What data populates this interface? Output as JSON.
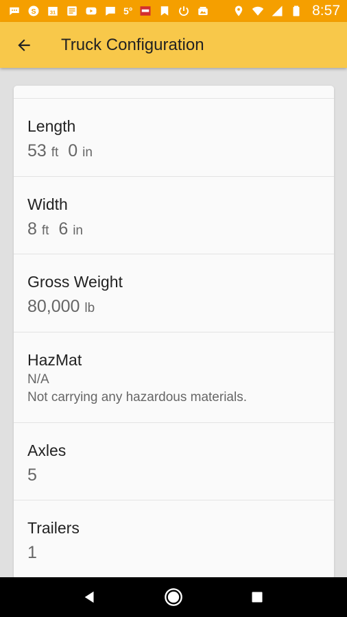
{
  "status_bar": {
    "clock": "8:57",
    "temperature": "5°",
    "icons": [
      "sms-icon",
      "skype-icon",
      "calendar-icon",
      "news-icon",
      "youtube-icon",
      "chat-icon",
      "weather-icon",
      "news-app-icon",
      "bookmark-icon",
      "power-icon",
      "photo-icon",
      "location-icon",
      "wifi-icon",
      "signal-icon",
      "battery-icon"
    ]
  },
  "app_bar": {
    "title": "Truck Configuration",
    "back_icon": "arrow-back-icon"
  },
  "settings": [
    {
      "label": "Length",
      "value_main": "53",
      "unit_main": "ft",
      "value_sub": "0",
      "unit_sub": "in"
    },
    {
      "label": "Width",
      "value_main": "8",
      "unit_main": "ft",
      "value_sub": "6",
      "unit_sub": "in"
    },
    {
      "label": "Gross Weight",
      "value_main": "80,000",
      "unit_main": "lb"
    },
    {
      "label": "HazMat",
      "value_line1": "N/A",
      "value_line2": "Not carrying any hazardous materials."
    },
    {
      "label": "Axles",
      "value_main": "5"
    },
    {
      "label": "Trailers",
      "value_main": "1"
    }
  ],
  "nav_bar": {
    "icons": [
      "back-triangle-icon",
      "home-circle-icon",
      "recents-square-icon"
    ]
  },
  "colors": {
    "status_bar": "#f59f00",
    "app_bar": "#f8c84a",
    "background": "#e0e0e0",
    "card": "#fafafa"
  }
}
